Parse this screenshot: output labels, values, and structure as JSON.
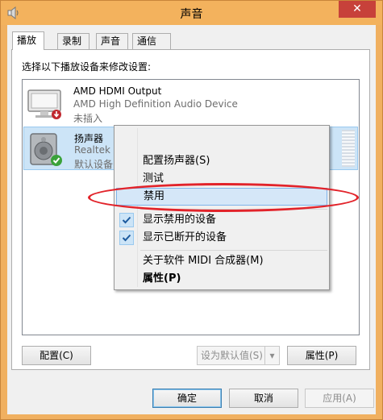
{
  "window": {
    "title": "声音",
    "close_label": "✕"
  },
  "tabs": [
    {
      "label": "播放",
      "active": true
    },
    {
      "label": "录制"
    },
    {
      "label": "声音"
    },
    {
      "label": "通信"
    }
  ],
  "panel": {
    "instruction": "选择以下播放设备来修改设置:"
  },
  "devices": [
    {
      "name": "AMD HDMI Output",
      "description": "AMD High Definition Audio Device",
      "status": "未插入",
      "icon": "monitor-icon",
      "badge": "unplugged-badge"
    },
    {
      "name": "扬声器",
      "description": "Realtek",
      "status": "默认设备",
      "icon": "speaker-icon",
      "badge": "default-check-badge",
      "selected": true
    }
  ],
  "buttons": {
    "configure": "配置(C)",
    "set_default": "设为默认值(S)",
    "properties": "属性(P)",
    "ok": "确定",
    "cancel": "取消",
    "apply": "应用(A)"
  },
  "context_menu": {
    "items": [
      {
        "label": "配置扬声器(S)"
      },
      {
        "label": "测试"
      },
      {
        "label": "禁用",
        "highlighted": true
      },
      {
        "label": "显示禁用的设备",
        "checked": true
      },
      {
        "label": "显示已断开的设备",
        "checked": true
      },
      {
        "label": "关于软件 MIDI 合成器(M)"
      },
      {
        "label": "属性(P)",
        "bold": true
      }
    ]
  },
  "colors": {
    "title_bar": "#f3b25d",
    "selection": "#cce4f7",
    "annotation": "#e2232a",
    "close_button": "#c7413a"
  }
}
